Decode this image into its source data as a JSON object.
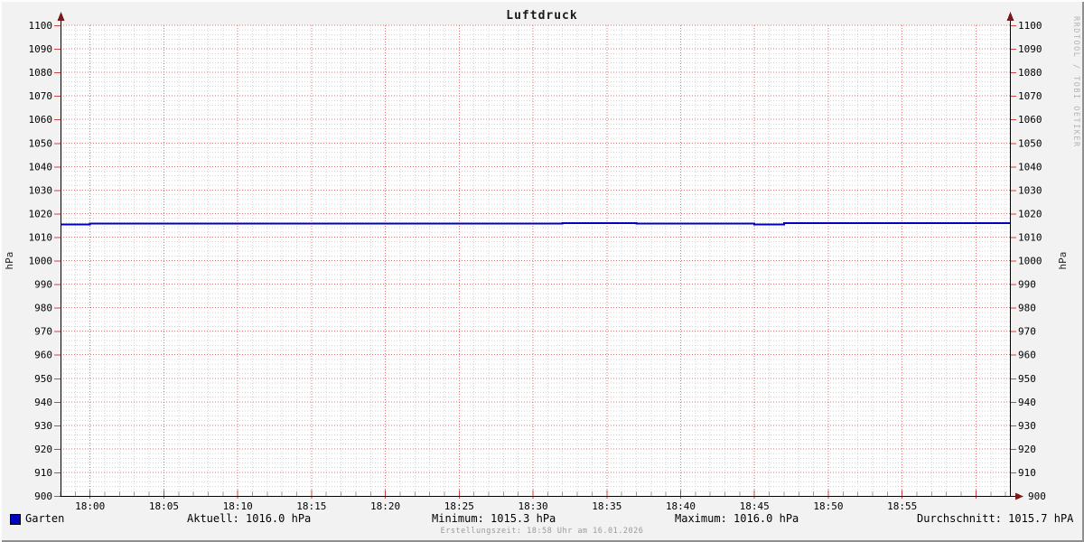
{
  "title": "Luftdruck",
  "watermark": "RRDTOOL / TOBI OETIKER",
  "creation_note": "Erstellungszeit: 18:58 Uhr am 16.01.2026",
  "legend": {
    "series_label": "Garten",
    "series_color": "#0000c0",
    "stats": [
      {
        "name": "current",
        "label": "Aktuell: 1016.0 hPa"
      },
      {
        "name": "minimum",
        "label": "Minimum: 1015.3 hPa"
      },
      {
        "name": "maximum",
        "label": "Maximum: 1016.0 hPa"
      },
      {
        "name": "average",
        "label": "Durchschnitt: 1015.7 hPA"
      }
    ]
  },
  "chart_data": {
    "type": "line",
    "title": "Luftdruck",
    "ylabel_left": "hPa",
    "ylabel_right": "hPa",
    "ylim": [
      900,
      1100
    ],
    "y_major_step": 10,
    "y_minor_step": 2,
    "x_ticks": [
      "18:00",
      "18:05",
      "18:10",
      "18:15",
      "18:20",
      "18:25",
      "18:30",
      "18:35",
      "18:40",
      "18:45",
      "18:50",
      "18:55"
    ],
    "x_minutes_range": [
      -2,
      62.3
    ],
    "x_major_step_min": 5,
    "x_minor_step_min": 1,
    "grid": {
      "on": true,
      "major_color": "#e07070",
      "minor_color": "#d4d4d4"
    },
    "axis_color": "#000000",
    "arrow_color": "#7a1a1a",
    "tick_color": "#cc4444",
    "plot_background": "#ffffff",
    "legend_position": "bottom",
    "series": [
      {
        "name": "Garten",
        "color": "#0000c0",
        "unit": "hPa",
        "step_points_minutes_from_1800": [
          [
            -2,
            1015.3
          ],
          [
            0,
            1015.7
          ],
          [
            32,
            1016.0
          ],
          [
            37,
            1015.7
          ],
          [
            45,
            1015.3
          ],
          [
            47,
            1016.0
          ],
          [
            62.3,
            1016.0
          ]
        ],
        "stats": {
          "current": 1016.0,
          "min": 1015.3,
          "max": 1016.0,
          "avg": 1015.7
        }
      }
    ]
  }
}
